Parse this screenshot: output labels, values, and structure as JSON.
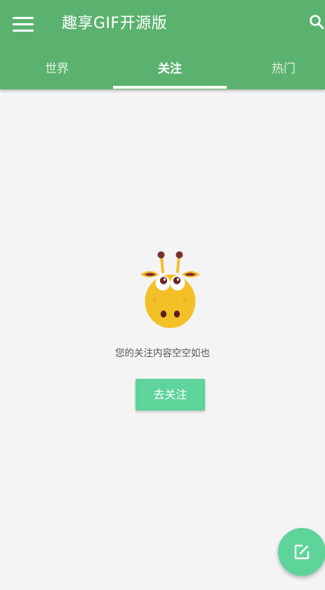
{
  "app_bar": {
    "title": "趣享GIF开源版",
    "menu_icon": "menu-icon",
    "search_icon": "search-icon",
    "background_color": "#5bb26e"
  },
  "tabs": [
    {
      "label": "世界",
      "active": false
    },
    {
      "label": "关注",
      "active": true
    },
    {
      "label": "热门",
      "active": false
    }
  ],
  "empty_state": {
    "illustration": "giraffe-illustration",
    "message": "您的关注内容空空如也",
    "button_label": "去关注",
    "button_color": "#5ed39a"
  },
  "fab": {
    "icon": "edit-icon",
    "color": "#5ed39a"
  }
}
